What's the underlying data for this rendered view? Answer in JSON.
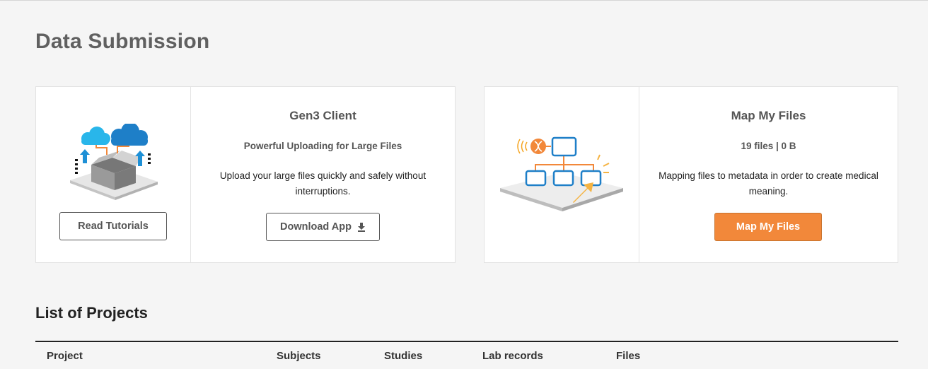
{
  "page": {
    "title": "Data Submission"
  },
  "gen3_card": {
    "title": "Gen3 Client",
    "subtitle": "Powerful Uploading for Large Files",
    "description": "Upload your large files quickly and safely without interruptions.",
    "read_tutorials_label": "Read Tutorials",
    "download_label": "Download App",
    "illustration_icon": "cloud-upload-box-icon",
    "download_icon": "download-icon"
  },
  "map_card": {
    "title": "Map My Files",
    "stats": "19 files | 0 B",
    "description": "Mapping files to metadata in order to create medical meaning.",
    "map_button_label": "Map My Files",
    "illustration_icon": "file-mapping-tree-icon"
  },
  "projects": {
    "section_title": "List of Projects",
    "columns": [
      "Project",
      "Subjects",
      "Studies",
      "Lab records",
      "Files"
    ]
  },
  "colors": {
    "accent_orange": "#f2883a",
    "cloud_blue": "#1e90d6",
    "cloud_light_blue": "#29b6ea",
    "title_gray": "#606060"
  }
}
